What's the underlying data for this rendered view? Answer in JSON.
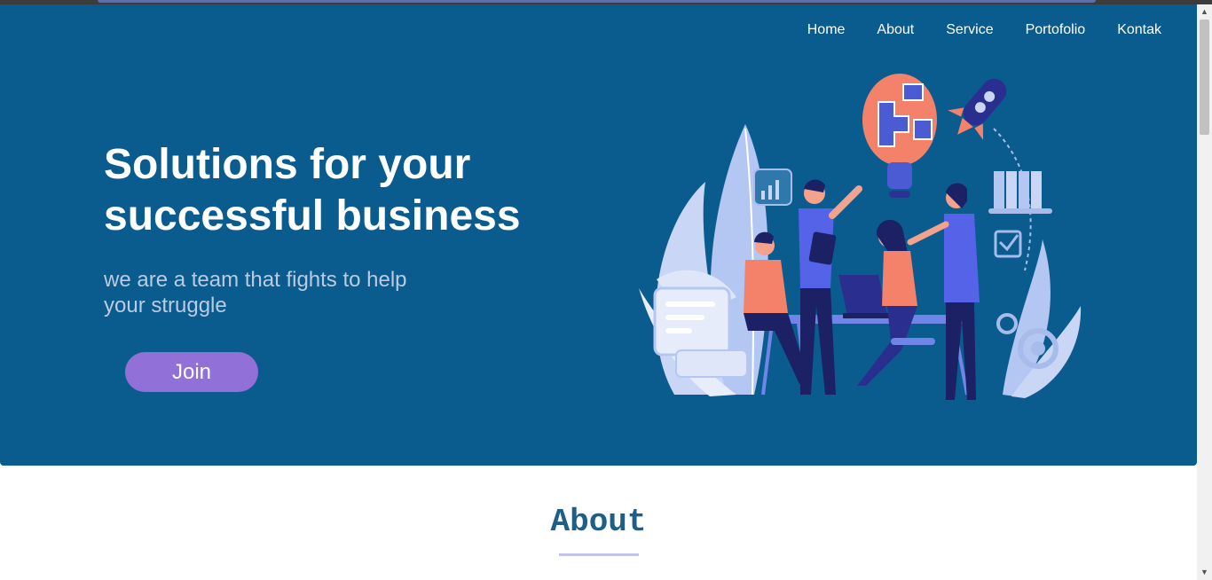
{
  "nav": {
    "items": [
      {
        "label": "Home"
      },
      {
        "label": "About"
      },
      {
        "label": "Service"
      },
      {
        "label": "Portofolio"
      },
      {
        "label": "Kontak"
      }
    ]
  },
  "hero": {
    "headline": "Solutions for your successful business",
    "tagline": "we are a team that fights to help your struggle",
    "join_label": "Join",
    "illustration": "team-collaboration-illustration",
    "colors": {
      "background": "#0b5c8e",
      "button": "#9170d8",
      "accent": "#f4826a"
    }
  },
  "about": {
    "title": "About"
  },
  "scrollbar": {
    "up_icon": "scroll-up-arrow-icon",
    "down_icon": "scroll-down-arrow-icon"
  }
}
